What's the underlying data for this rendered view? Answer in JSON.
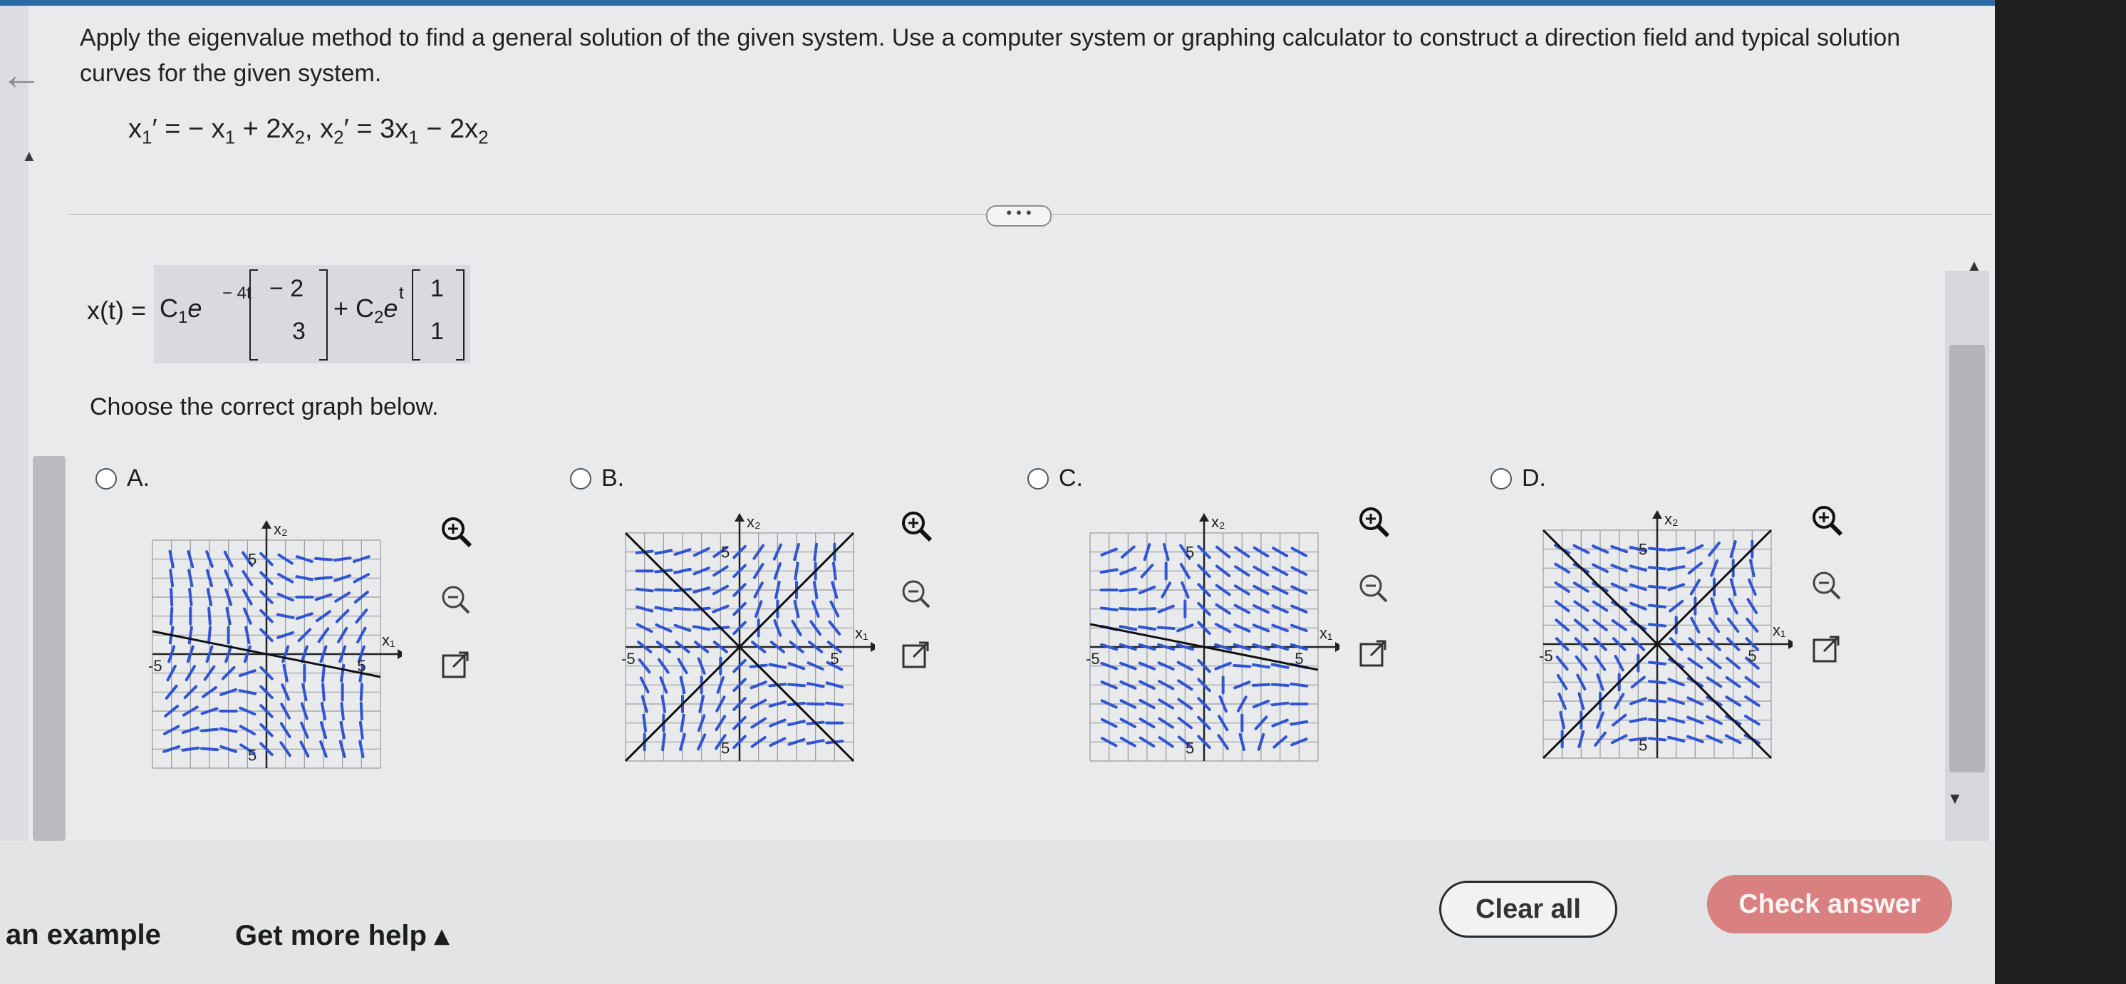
{
  "question": {
    "text": "Apply the eigenvalue method to find a general solution of the given system. Use a computer system or graphing calculator to construct a direction field and typical solution curves for the given system."
  },
  "more_button": "• • •",
  "answer": {
    "label": "x(t) =",
    "c1": "C",
    "exp1": "− 4t",
    "vec1": [
      "− 2",
      "3"
    ],
    "c2": "+ C",
    "exp2": "t",
    "vec2": [
      "1",
      "1"
    ]
  },
  "prompt": "Choose the correct graph below.",
  "options": [
    {
      "letter": "A.",
      "xlabel": "x₁",
      "ylabel": "x₂",
      "tick_top": "5",
      "tick_bottom": "5",
      "tick_left": "-5",
      "tick_right": "5"
    },
    {
      "letter": "B.",
      "xlabel": "x₁",
      "ylabel": "x₂",
      "tick_top": "5",
      "tick_bottom": "5",
      "tick_left": "-5",
      "tick_right": "5"
    },
    {
      "letter": "C.",
      "xlabel": "x₁",
      "ylabel": "x₂",
      "tick_top": "5",
      "tick_bottom": "5",
      "tick_left": "-5",
      "tick_right": "5"
    },
    {
      "letter": "D.",
      "xlabel": "x₁",
      "ylabel": "x₂",
      "tick_top": "5",
      "tick_bottom": "5",
      "tick_left": "-5",
      "tick_right": "5"
    }
  ],
  "footer": {
    "example_link": "an example",
    "help_link": "Get more help ▴",
    "clear_button": "Clear all",
    "check_button": "Check answer"
  },
  "colors": {
    "arrow": "#2f55d4",
    "grid": "#9a9a9a",
    "accent_top": "#2d6aa4",
    "check": "#d98181"
  }
}
